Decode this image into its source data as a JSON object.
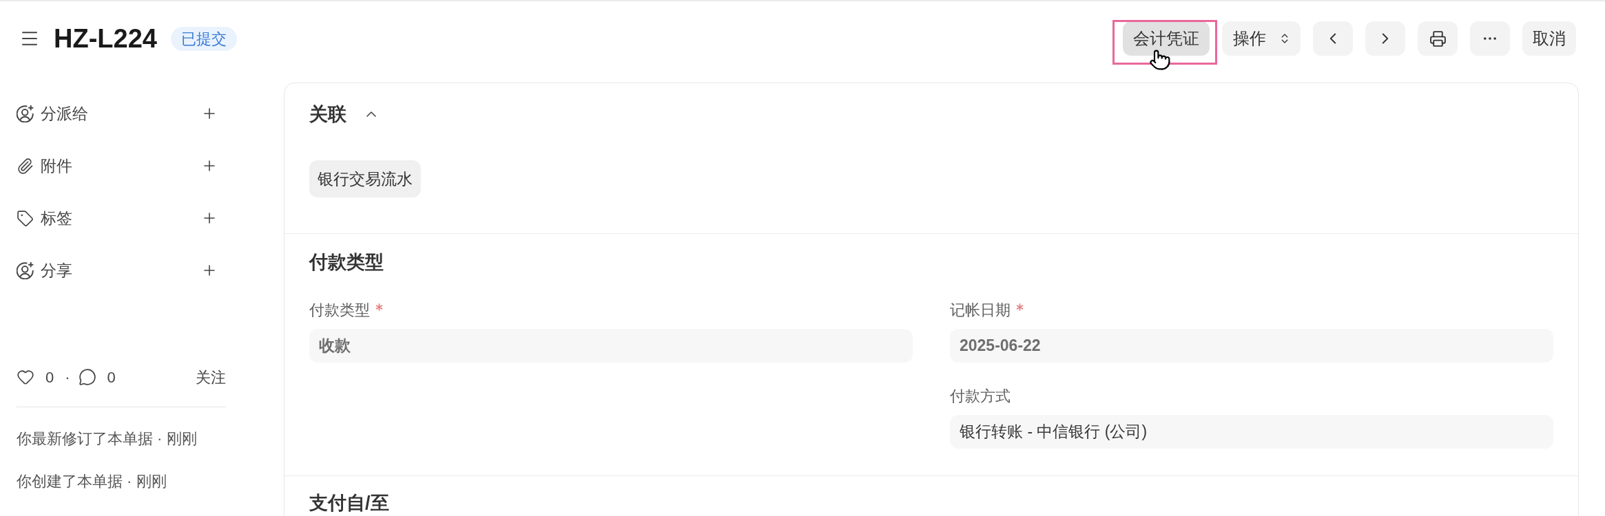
{
  "header": {
    "title": "HZ-L224",
    "status": "已提交"
  },
  "toolbar": {
    "buttons": [
      {
        "kind": "text",
        "label": "会计凭证",
        "hovered": true,
        "highlighted": true
      },
      {
        "kind": "dropdown",
        "label": "操作",
        "hovered": false,
        "highlighted": false
      },
      {
        "kind": "prev",
        "hovered": false,
        "highlighted": false
      },
      {
        "kind": "next",
        "hovered": false,
        "highlighted": false
      },
      {
        "kind": "print",
        "hovered": false,
        "highlighted": false
      },
      {
        "kind": "more",
        "hovered": false,
        "highlighted": false
      },
      {
        "kind": "text",
        "label": "取消",
        "hovered": false,
        "highlighted": false
      }
    ]
  },
  "sidebar": {
    "items": [
      {
        "kind": "assign",
        "label": "分派给"
      },
      {
        "kind": "attachment",
        "label": "附件"
      },
      {
        "kind": "tag",
        "label": "标签"
      },
      {
        "kind": "share",
        "label": "分享"
      }
    ],
    "social": {
      "likes": "0",
      "separator": "·",
      "comments": "0",
      "follow": "关注"
    },
    "activity": [
      "你最新修订了本单据 · 刚刚",
      "你创建了本单据 · 刚刚"
    ]
  },
  "form": {
    "connections": {
      "title": "关联",
      "expanded": true,
      "links": [
        "银行交易流水"
      ]
    },
    "sections": [
      {
        "title": "付款类型",
        "columns": [
          [
            {
              "label": "付款类型",
              "required": true,
              "value": "收款",
              "disabled": true
            }
          ],
          [
            {
              "label": "记帐日期",
              "required": true,
              "value": "2025-06-22",
              "disabled": true
            },
            {
              "label": "付款方式",
              "required": false,
              "value": "银行转账 - 中信银行 (公司)",
              "disabled": false
            }
          ]
        ]
      },
      {
        "title": "支付自/至"
      }
    ]
  }
}
